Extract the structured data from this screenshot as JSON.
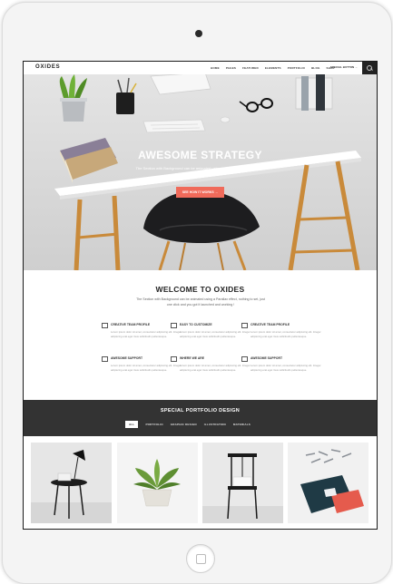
{
  "nav": {
    "logo": "OXIDES",
    "menu": [
      "HOME",
      "PAGES",
      "FEATURED",
      "ELEMENTS",
      "PORTFOLIO",
      "BLOG",
      "SHOP"
    ],
    "special": "SPECIAL BUTTON →"
  },
  "hero": {
    "title": "AWESOME STRATEGY",
    "text": "The Section with Background can be animated using a Parallax effect, nothing to set, just one click and you got it.",
    "button": "SEE HOW IT WORKS →"
  },
  "welcome": {
    "title": "WELCOME TO OXIDES",
    "text": "The Section with Background can be animated using a Parallax effect, nothing to set, just one click and you got it launched and working !"
  },
  "features": [
    {
      "title": "CREATIVE TEAM PROFILE",
      "text": "Lorem ipsum dolor sit amet, consectetur adipiscing elit. Integer adipiscing erat eget risus sollicitudin pellentesque."
    },
    {
      "title": "EASY TO CUSTOMIZE",
      "text": "Lorem ipsum dolor sit amet, consectetur adipiscing elit. Integer adipiscing erat eget risus sollicitudin pellentesque."
    },
    {
      "title": "CREATIVE TEAM PROFILE",
      "text": "Lorem ipsum dolor sit amet, consectetur adipiscing elit. Integer adipiscing erat eget risus sollicitudin pellentesque."
    },
    {
      "title": "AWESOME SUPPORT",
      "text": "Lorem ipsum dolor sit amet, consectetur adipiscing elit. Integer adipiscing erat eget risus sollicitudin pellentesque."
    },
    {
      "title": "WHERE WE ARE",
      "text": "Lorem ipsum dolor sit amet, consectetur adipiscing elit. Integer adipiscing erat eget risus sollicitudin pellentesque."
    },
    {
      "title": "AWESOME SUPPORT",
      "text": "Lorem ipsum dolor sit amet, consectetur adipiscing elit. Integer adipiscing erat eget risus sollicitudin pellentesque."
    }
  ],
  "portfolio": {
    "title": "SPECIAL PORTFOLIO DESIGN",
    "filters": [
      "ALL",
      "PORTFOLIO",
      "GRAPHIC DESIGN",
      "ILLUSTRATION",
      "MATERIALS"
    ]
  },
  "colors": {
    "accent": "#f06a5a",
    "dark_band": "#333333"
  }
}
